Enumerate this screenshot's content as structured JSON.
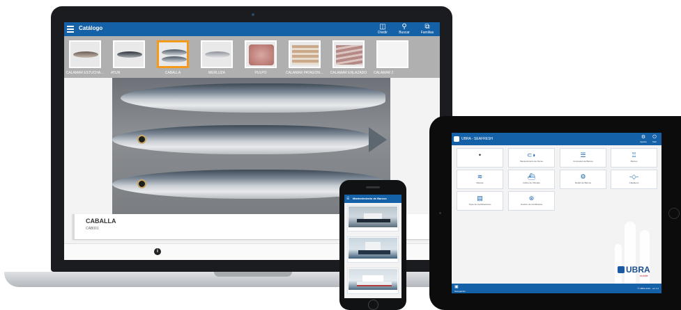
{
  "laptop_app": {
    "header": {
      "title": "Catálogo",
      "actions": [
        {
          "label": "Dividir",
          "icon": "split-view-icon"
        },
        {
          "label": "Buscar",
          "icon": "search-icon"
        },
        {
          "label": "Familias",
          "icon": "hierarchy-icon"
        }
      ]
    },
    "thumbnails": [
      {
        "label": "CALAMAR ESTUCHA…",
        "selected": false
      },
      {
        "label": "ATUN",
        "selected": false
      },
      {
        "label": "CABALLA",
        "selected": true
      },
      {
        "label": "MERLUZA",
        "selected": false
      },
      {
        "label": "PULPO",
        "selected": false
      },
      {
        "label": "CALAMAR PATAGON…",
        "selected": false
      },
      {
        "label": "CALAMAR ENLAZADO",
        "selected": false
      },
      {
        "label": "CALAMAR 2",
        "selected": false
      }
    ],
    "product": {
      "name": "CABALLA",
      "code": "CAB001"
    },
    "footer_icon": "info-icon",
    "accent_color": "#1561a8",
    "selection_color": "#f39a1b"
  },
  "tablet_app": {
    "header_title": "UBRA - SEAFRESH",
    "header_actions": [
      {
        "label": "Ajustes",
        "icon": "settings-icon"
      },
      {
        "label": "Salir",
        "icon": "power-icon"
      }
    ],
    "tiles": [
      {
        "label": "",
        "icon": "dot-icon"
      },
      {
        "label": "Mantenimiento de Peces",
        "icon": "fish-icon"
      },
      {
        "label": "Conceptos de Barcos",
        "icon": "list-icon"
      },
      {
        "label": "Marcos",
        "icon": "bag-icon"
      },
      {
        "label": "Mareas",
        "icon": "waves-icon"
      },
      {
        "label": "Caños de Ubicado",
        "icon": "ship-icon"
      },
      {
        "label": "Redes de Barcos",
        "icon": "gear-icon"
      },
      {
        "label": "Caladeros",
        "icon": "fish-outline-icon"
      },
      {
        "label": "Tipos de Certificaciones",
        "icon": "document-icon"
      },
      {
        "label": "Gestión de Certificados",
        "icon": "badge-icon"
      }
    ],
    "bottom_left_label": "Navegación",
    "bottom_right_label": "© UBRA 2016 · ver 1.0",
    "logo_text": "UBRA",
    "logo_sub": "mobile"
  },
  "phone_app": {
    "header_title": "Mantenimiento de Barcos",
    "menu_icon": "menu-icon",
    "cards": [
      {
        "image": "fishing-vessel-1"
      },
      {
        "image": "fishing-vessel-2"
      },
      {
        "image": "fishing-vessel-3"
      }
    ]
  }
}
